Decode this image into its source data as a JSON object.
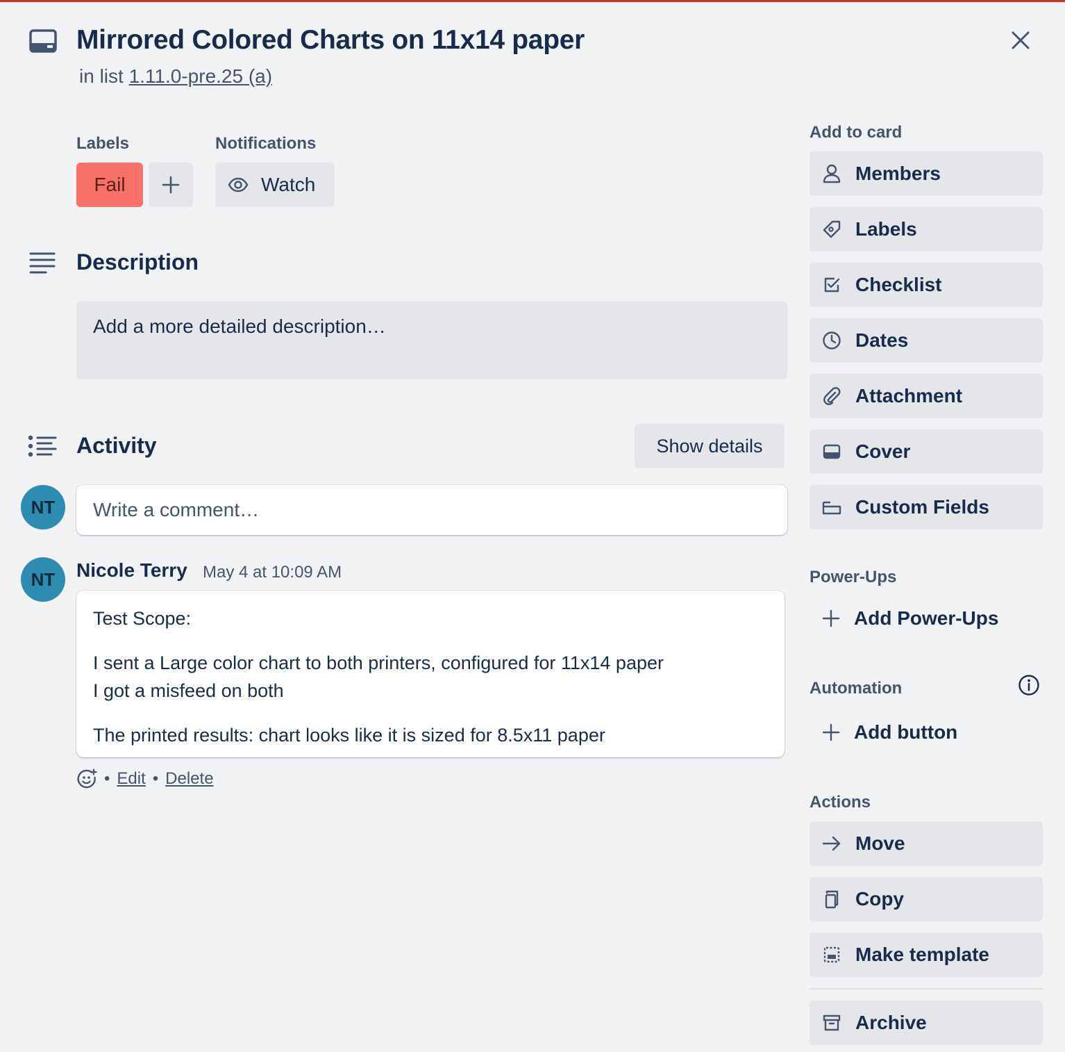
{
  "card": {
    "title": "Mirrored Colored Charts on 11x14 paper",
    "in_list_prefix": "in list",
    "list_name": "1.11.0-pre.25 (a)"
  },
  "labels": {
    "heading": "Labels",
    "items": [
      {
        "text": "Fail",
        "color": "#f87168"
      }
    ]
  },
  "notifications": {
    "heading": "Notifications",
    "watch_label": "Watch"
  },
  "description": {
    "heading": "Description",
    "placeholder": "Add a more detailed description…"
  },
  "activity": {
    "heading": "Activity",
    "show_details_label": "Show details",
    "comment_placeholder": "Write a comment…",
    "current_user_initials": "NT",
    "comments": [
      {
        "initials": "NT",
        "author": "Nicole Terry",
        "timestamp": "May 4 at 10:09 AM",
        "lines": [
          "Test Scope:",
          "I sent a Large color chart to both printers, configured for 11x14 paper",
          "I got a misfeed on both",
          "The printed results: chart looks like it is sized for 8.5x11 paper"
        ],
        "edit_label": "Edit",
        "delete_label": "Delete",
        "separator": "•"
      }
    ]
  },
  "sidebar": {
    "add_to_card": {
      "heading": "Add to card",
      "items": [
        {
          "label": "Members",
          "icon": "person-icon"
        },
        {
          "label": "Labels",
          "icon": "tag-icon"
        },
        {
          "label": "Checklist",
          "icon": "checkbox-icon"
        },
        {
          "label": "Dates",
          "icon": "clock-icon"
        },
        {
          "label": "Attachment",
          "icon": "paperclip-icon"
        },
        {
          "label": "Cover",
          "icon": "card-cover-icon"
        },
        {
          "label": "Custom Fields",
          "icon": "custom-fields-icon"
        }
      ]
    },
    "power_ups": {
      "heading": "Power-Ups",
      "add_label": "Add Power-Ups"
    },
    "automation": {
      "heading": "Automation",
      "add_label": "Add button"
    },
    "actions": {
      "heading": "Actions",
      "items": [
        {
          "label": "Move",
          "icon": "arrow-right-icon"
        },
        {
          "label": "Copy",
          "icon": "copy-icon"
        },
        {
          "label": "Make template",
          "icon": "template-icon"
        },
        {
          "label": "Archive",
          "icon": "archive-icon"
        }
      ]
    }
  },
  "colors": {
    "accent_top_bar": "#c9372c",
    "background": "#f1f2f4",
    "button_bg": "#e4e6ea",
    "avatar": "#2e8cb0",
    "text": "#172b4d",
    "subtle_text": "#44546f"
  }
}
